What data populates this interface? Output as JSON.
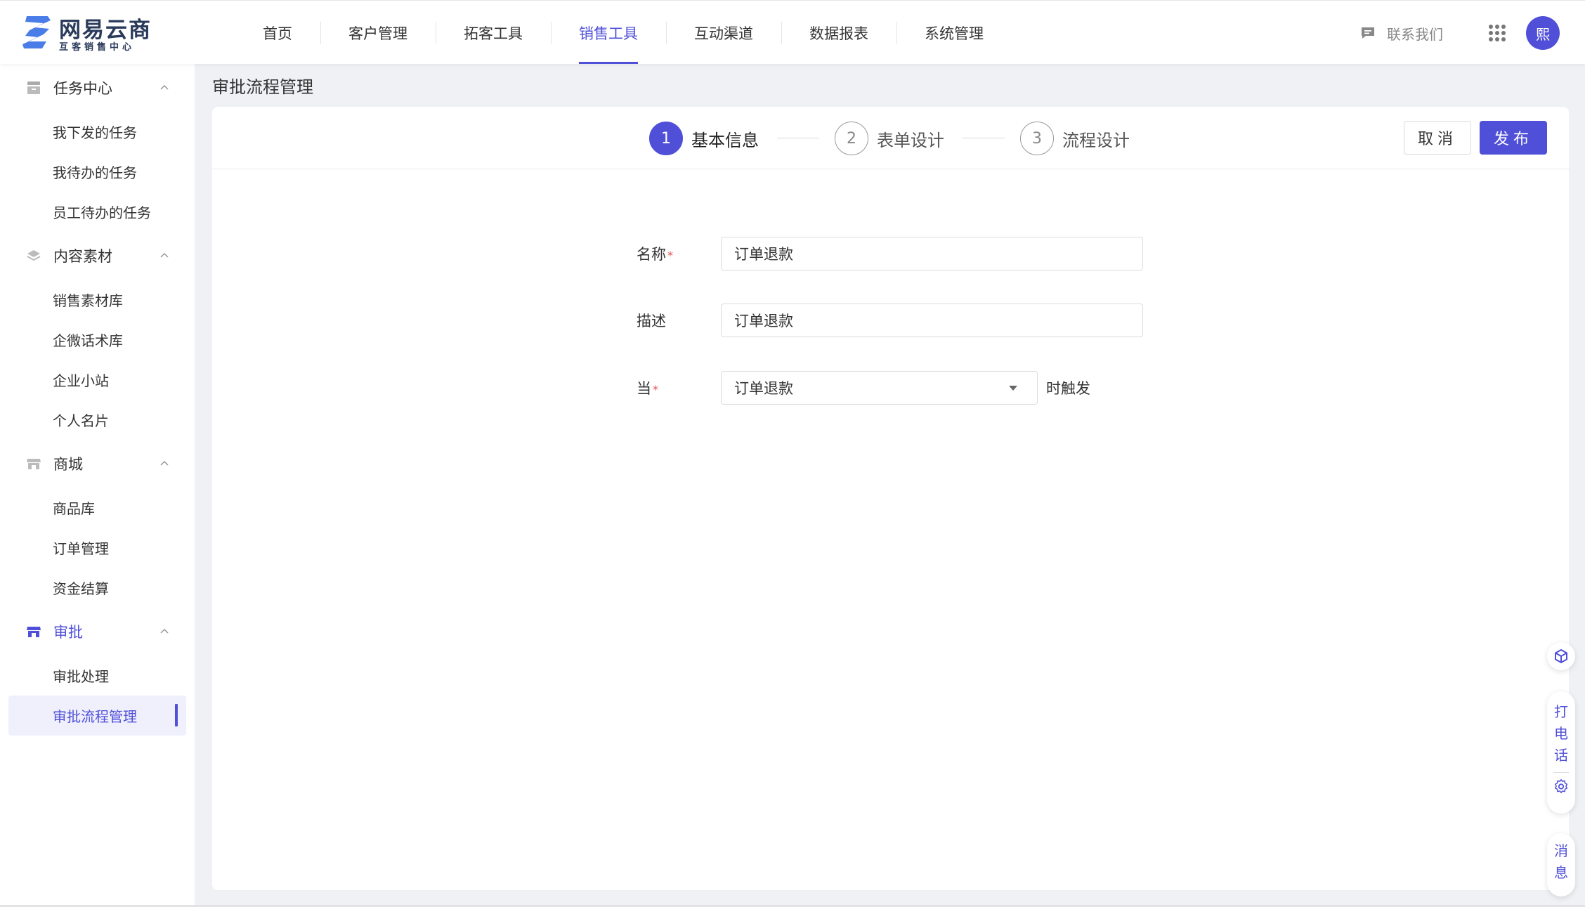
{
  "brand": {
    "title": "网易云商",
    "subtitle": "互客销售中心"
  },
  "nav": {
    "items": [
      {
        "label": "首页"
      },
      {
        "label": "客户管理"
      },
      {
        "label": "拓客工具"
      },
      {
        "label": "销售工具"
      },
      {
        "label": "互动渠道"
      },
      {
        "label": "数据报表"
      },
      {
        "label": "系统管理"
      }
    ],
    "active": "销售工具"
  },
  "header": {
    "contact_label": "联系我们",
    "avatar_text": "熙"
  },
  "sidebar": {
    "groups": [
      {
        "label": "任务中心",
        "icon": "task-icon",
        "items": [
          "我下发的任务",
          "我待办的任务",
          "员工待办的任务"
        ]
      },
      {
        "label": "内容素材",
        "icon": "layers-icon",
        "items": [
          "销售素材库",
          "企微话术库",
          "企业小站",
          "个人名片"
        ]
      },
      {
        "label": "商城",
        "icon": "store-icon",
        "items": [
          "商品库",
          "订单管理",
          "资金结算"
        ]
      },
      {
        "label": "审批",
        "icon": "approval-icon",
        "items": [
          "审批处理",
          "审批流程管理"
        ]
      }
    ],
    "active_group": "审批",
    "active_item": "审批流程管理"
  },
  "page": {
    "title": "审批流程管理"
  },
  "steps": [
    {
      "num": "1",
      "label": "基本信息",
      "active": true
    },
    {
      "num": "2",
      "label": "表单设计",
      "active": false
    },
    {
      "num": "3",
      "label": "流程设计",
      "active": false
    }
  ],
  "actions": {
    "cancel_label": "取消",
    "publish_label": "发布"
  },
  "form": {
    "name": {
      "label": "名称",
      "required": "*",
      "value": "订单退款"
    },
    "desc": {
      "label": "描述",
      "value": "订单退款"
    },
    "trigger": {
      "label": "当",
      "required": "*",
      "value": "订单退款",
      "suffix": "时触发"
    }
  },
  "float": {
    "call_label": "打电话",
    "message_label": "消息"
  },
  "colors": {
    "accent": "#4f4fd8",
    "required": "#e05050"
  }
}
